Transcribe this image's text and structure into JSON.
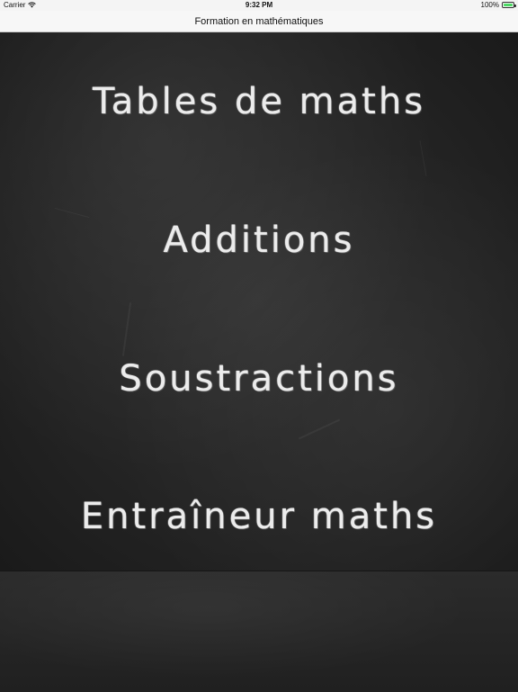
{
  "status_bar": {
    "carrier": "Carrier",
    "time": "9:32 PM",
    "battery": "100%",
    "battery_color": "#4cd964"
  },
  "nav_bar": {
    "title": "Formation en mathématiques"
  },
  "menu": {
    "items": [
      {
        "label": "Tables de maths"
      },
      {
        "label": "Additions"
      },
      {
        "label": "Soustractions"
      },
      {
        "label": "Entraîneur maths"
      }
    ]
  },
  "icons": {
    "wifi": "wifi-icon",
    "battery": "battery-icon"
  }
}
